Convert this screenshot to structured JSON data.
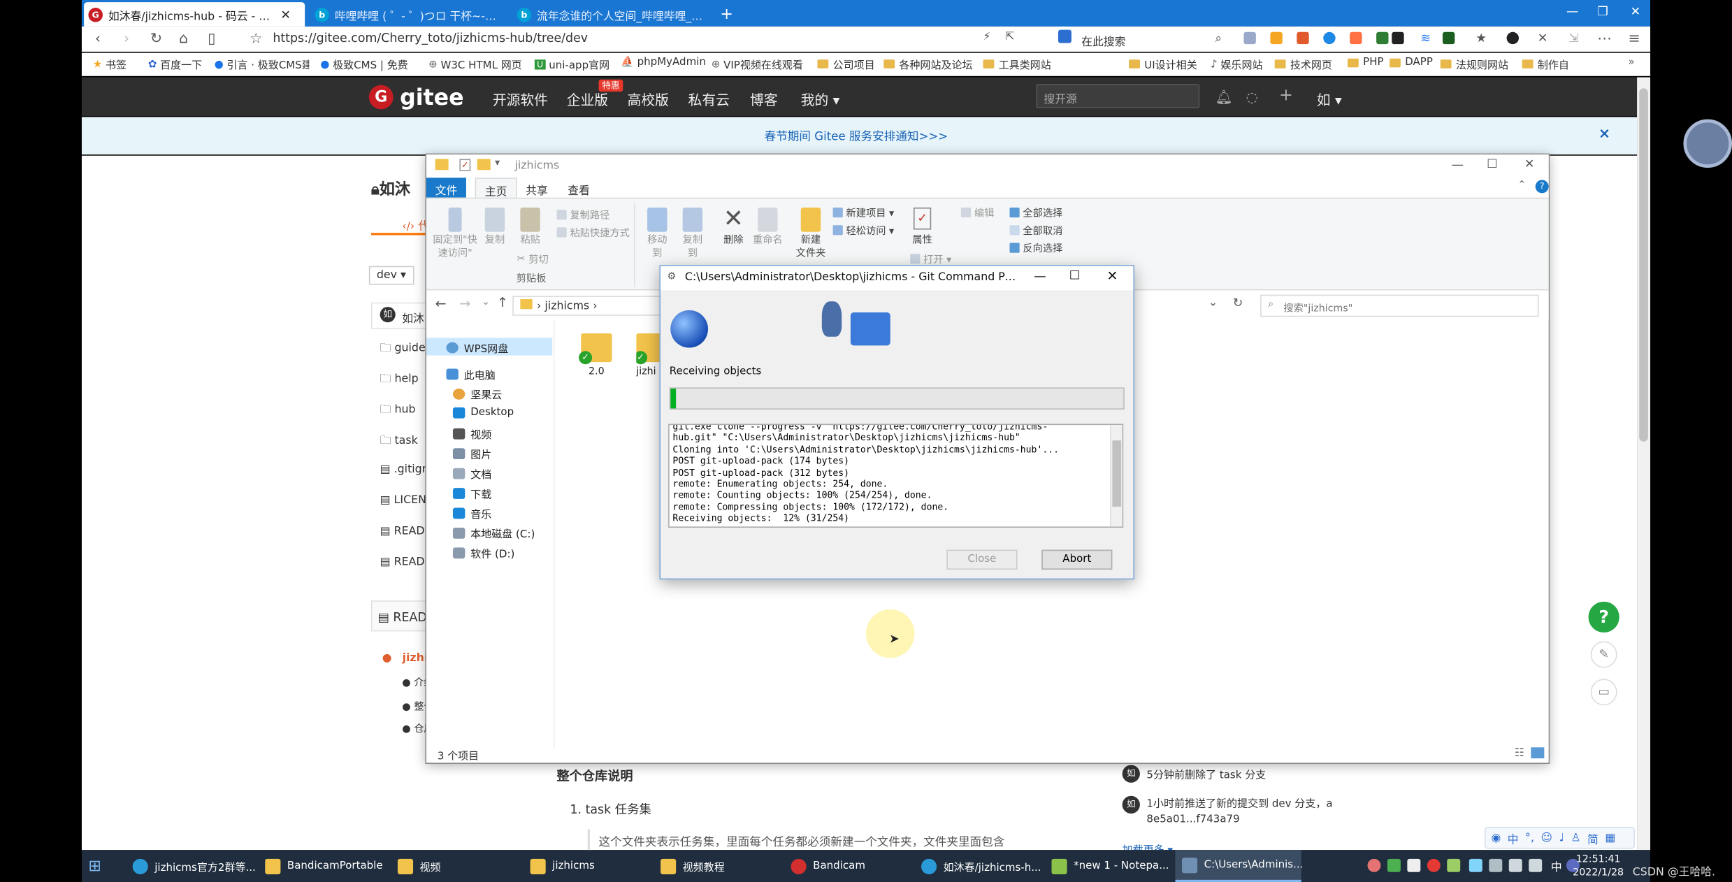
{
  "browser": {
    "tabs": [
      {
        "label": "如沐春/jizhicms-hub - 码云 - 开源中国",
        "active": true
      },
      {
        "label": "哔哩哔哩 ( ゜- ゜)つロ 干杯~-bilibili",
        "active": false
      },
      {
        "label": "流年念谁的个人空间_哔哩哔哩_bilibili",
        "active": false
      }
    ],
    "url": "https://gitee.com/Cherry_toto/jizhicms-hub/tree/dev",
    "search_label": "在此搜索",
    "bookmarks": [
      "书签",
      "百度一下",
      "引言 · 极致CMS建",
      "极致CMS | 免费",
      "W3C HTML 网页",
      "uni-app官网",
      "phpMyAdmin",
      "VIP视频在线观看",
      "公司项目",
      "各种网站及论坛",
      "工具类网站",
      "UI设计相关",
      "娱乐网站",
      "技术网页",
      "PHP",
      "DAPP",
      "法规则网站",
      "制作自"
    ]
  },
  "gitee": {
    "brand": "gitee",
    "nav": [
      "开源软件",
      "企业版",
      "高校版",
      "私有云",
      "博客",
      "我的 ▾"
    ],
    "badge": "特惠",
    "search_placeholder": "搜开源",
    "user_initial": "如",
    "notice": "春节期间 Gitee 服务安排通知>>>",
    "notice_close": "×",
    "repo_title": "如沐",
    "branch": "dev ▾",
    "owner_initial": "如",
    "owner": "如沐",
    "files": [
      "guide",
      "help",
      "hub",
      "task",
      ".gitign",
      "LICEN",
      "READ",
      "READ"
    ],
    "readme_label": "READ",
    "readme_item": "jizhic",
    "bullets": [
      "介绍",
      "整个",
      "仓库"
    ],
    "section_title": "整个仓库说明",
    "list_item": "1. task 任务集",
    "paragraph": "这个文件夹表示任务集，里面每个任务都必须新建一个文件夹，文件夹里面包含",
    "activity": [
      {
        "avatar": "如",
        "text": "5分钟前删除了 task 分支"
      },
      {
        "avatar": "如",
        "text": "1小时前推送了新的提交到 dev 分支，a 8e5a01...f743a79"
      }
    ],
    "more": "加载更多 ▾",
    "help_icon": "?"
  },
  "explorer": {
    "title": "jizhicms",
    "menu": [
      "文件",
      "主页",
      "共享",
      "查看"
    ],
    "ribbon": {
      "pin": "固定到\"快\n速访问\"",
      "copy": "复制",
      "paste": "粘贴",
      "copy_path": "复制路径",
      "paste_shortcut": "粘贴快捷方式",
      "cut": "剪切",
      "clipboard_group": "剪贴板",
      "move_to": "移动到",
      "copy_to": "复制到",
      "delete": "删除",
      "rename": "重命名",
      "new_folder": "新建\n文件夹",
      "new_item": "新建项目 ▾",
      "easy_access": "轻松访问 ▾",
      "properties": "属性",
      "open": "打开 ▾",
      "edit": "编辑",
      "select_all": "全部选择",
      "select_none": "全部取消",
      "invert": "反向选择"
    },
    "breadcrumb": "jizhicms",
    "search_placeholder": "搜索\"jizhicms\"",
    "tree": [
      "WPS网盘",
      "此电脑",
      "坚果云",
      "Desktop",
      "视频",
      "图片",
      "文档",
      "下载",
      "音乐",
      "本地磁盘 (C:)",
      "软件 (D:)"
    ],
    "items": [
      "2.0",
      "jizhi"
    ],
    "status": "3 个项目"
  },
  "git_dialog": {
    "title": "C:\\Users\\Administrator\\Desktop\\jizhicms - Git Command Progress - ...",
    "status": "Receiving objects",
    "progress": 0.12,
    "log": [
      "git.exe clone --progress -v \"https://gitee.com/Cherry_toto/jizhicms-",
      "hub.git\" \"C:\\Users\\Administrator\\Desktop\\jizhicms\\jizhicms-hub\"",
      "Cloning into 'C:\\Users\\Administrator\\Desktop\\jizhicms\\jizhicms-hub'...",
      "POST git-upload-pack (174 bytes)",
      "POST git-upload-pack (312 bytes)",
      "remote: Enumerating objects: 254, done.",
      "remote: Counting objects: 100% (254/254), done.",
      "remote: Compressing objects: 100% (172/172), done.",
      "Receiving objects:  12% (31/254)"
    ],
    "close_label": "Close",
    "abort_label": "Abort"
  },
  "taskbar": {
    "items": [
      {
        "label": "jizhicms官方2群等...",
        "active": false
      },
      {
        "label": "BandicamPortable",
        "active": false
      },
      {
        "label": "视频",
        "active": false
      },
      {
        "label": "jizhicms",
        "active": false
      },
      {
        "label": "视频教程",
        "active": false
      },
      {
        "label": "Bandicam",
        "active": false
      },
      {
        "label": "如沐春/jizhicms-h...",
        "active": false
      },
      {
        "label": "*new 1 - Notepa...",
        "active": false
      },
      {
        "label": "C:\\Users\\Adminis...",
        "active": true
      }
    ],
    "ime": [
      "中",
      "简"
    ],
    "time": "12:51:41",
    "date": "2022/1/28",
    "watermark": "CSDN @王哈哈."
  },
  "colors": {
    "tab_bar": "#1976d2",
    "gitee_red": "#c71d23",
    "progress": "#06b025",
    "taskbar": "#1f2d3e"
  }
}
